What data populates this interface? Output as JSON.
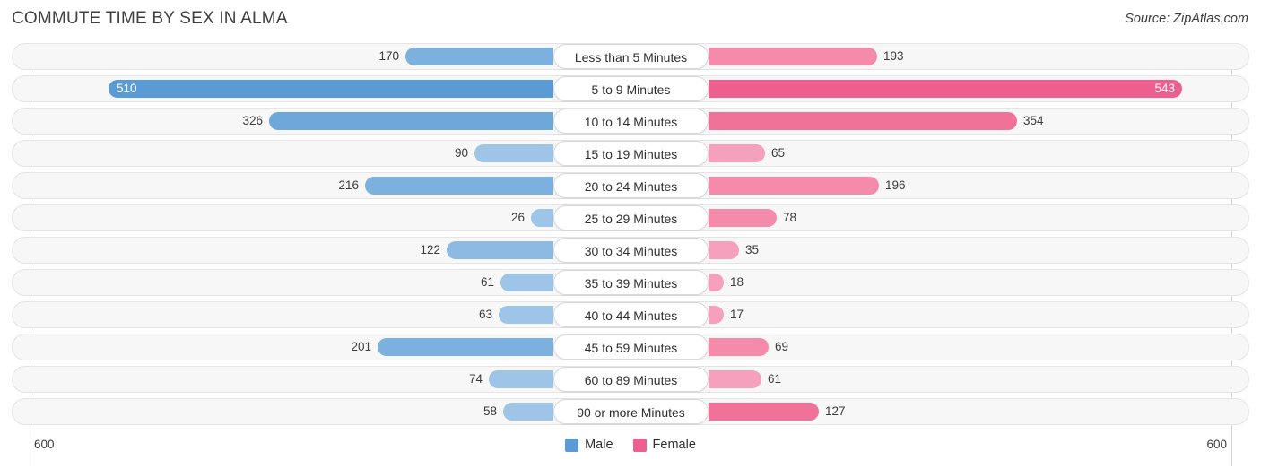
{
  "header": {
    "title": "COMMUTE TIME BY SEX IN ALMA",
    "source": "Source: ZipAtlas.com"
  },
  "axis": {
    "left_tick": "600",
    "right_tick": "600",
    "max": 600
  },
  "legend": {
    "items": [
      {
        "label": "Male",
        "color": "#5b9bd5",
        "swatch": "male-swatch"
      },
      {
        "label": "Female",
        "color": "#ed5f8f",
        "swatch": "female-swatch"
      }
    ]
  },
  "colors": {
    "male_strong": "#5b9bd5",
    "male_light": "#9ec4e8",
    "female_strong": "#ed5f8f",
    "female_light": "#f58bab",
    "female_lighter": "#f5a0bd",
    "track_bg": "#f7f7f7",
    "track_border": "#e4e4e4",
    "axis": "#d3d3d3",
    "text": "#3c3c3c"
  },
  "chart_data": {
    "type": "bar",
    "subtype": "diverging-bidirectional",
    "title": "COMMUTE TIME BY SEX IN ALMA",
    "xlabel": "",
    "ylabel": "",
    "xlim": [
      600,
      600
    ],
    "grid": false,
    "legend_position": "bottom-center",
    "categories": [
      "Less than 5 Minutes",
      "5 to 9 Minutes",
      "10 to 14 Minutes",
      "15 to 19 Minutes",
      "20 to 24 Minutes",
      "25 to 29 Minutes",
      "30 to 34 Minutes",
      "35 to 39 Minutes",
      "40 to 44 Minutes",
      "45 to 59 Minutes",
      "60 to 89 Minutes",
      "90 or more Minutes"
    ],
    "series": [
      {
        "name": "Male",
        "direction": "left",
        "color": "#5b9bd5",
        "values": [
          170,
          510,
          326,
          90,
          216,
          26,
          122,
          61,
          63,
          201,
          74,
          58
        ]
      },
      {
        "name": "Female",
        "direction": "right",
        "color": "#ed5f8f",
        "values": [
          193,
          543,
          354,
          65,
          196,
          78,
          35,
          18,
          17,
          69,
          61,
          127
        ]
      }
    ]
  },
  "rows": [
    {
      "label": "Less than 5 Minutes",
      "male": 170,
      "female": 193,
      "male_text": "170",
      "female_text": "193",
      "male_inside": false,
      "female_inside": false,
      "male_color": "#7cb0de",
      "female_color": "#f58bab"
    },
    {
      "label": "5 to 9 Minutes",
      "male": 510,
      "female": 543,
      "male_text": "510",
      "female_text": "543",
      "male_inside": true,
      "female_inside": true,
      "male_color": "#5b9bd5",
      "female_color": "#ed5f8f"
    },
    {
      "label": "10 to 14 Minutes",
      "male": 326,
      "female": 354,
      "male_text": "326",
      "female_text": "354",
      "male_inside": false,
      "female_inside": false,
      "male_color": "#6ea8da",
      "female_color": "#f07299"
    },
    {
      "label": "15 to 19 Minutes",
      "male": 90,
      "female": 65,
      "male_text": "90",
      "female_text": "65",
      "male_inside": false,
      "female_inside": false,
      "male_color": "#9ec4e8",
      "female_color": "#f5a0bd"
    },
    {
      "label": "20 to 24 Minutes",
      "male": 216,
      "female": 196,
      "male_text": "216",
      "female_text": "196",
      "male_inside": false,
      "female_inside": false,
      "male_color": "#7cb0de",
      "female_color": "#f58bab"
    },
    {
      "label": "25 to 29 Minutes",
      "male": 26,
      "female": 78,
      "male_text": "26",
      "female_text": "78",
      "male_inside": false,
      "female_inside": false,
      "male_color": "#9ec4e8",
      "female_color": "#f58bab"
    },
    {
      "label": "30 to 34 Minutes",
      "male": 122,
      "female": 35,
      "male_text": "122",
      "female_text": "35",
      "male_inside": false,
      "female_inside": false,
      "male_color": "#8dbae3",
      "female_color": "#f5a0bd"
    },
    {
      "label": "35 to 39 Minutes",
      "male": 61,
      "female": 18,
      "male_text": "61",
      "female_text": "18",
      "male_inside": false,
      "female_inside": false,
      "male_color": "#9ec4e8",
      "female_color": "#f5a0bd"
    },
    {
      "label": "40 to 44 Minutes",
      "male": 63,
      "female": 17,
      "male_text": "63",
      "female_text": "17",
      "male_inside": false,
      "female_inside": false,
      "male_color": "#9ec4e8",
      "female_color": "#f5a0bd"
    },
    {
      "label": "45 to 59 Minutes",
      "male": 201,
      "female": 69,
      "male_text": "201",
      "female_text": "69",
      "male_inside": false,
      "female_inside": false,
      "male_color": "#7cb0de",
      "female_color": "#f58bab"
    },
    {
      "label": "60 to 89 Minutes",
      "male": 74,
      "female": 61,
      "male_text": "74",
      "female_text": "61",
      "male_inside": false,
      "female_inside": false,
      "male_color": "#9ec4e8",
      "female_color": "#f5a0bd"
    },
    {
      "label": "90 or more Minutes",
      "male": 58,
      "female": 127,
      "male_text": "58",
      "female_text": "127",
      "male_inside": false,
      "female_inside": false,
      "male_color": "#9ec4e8",
      "female_color": "#f07299"
    }
  ]
}
